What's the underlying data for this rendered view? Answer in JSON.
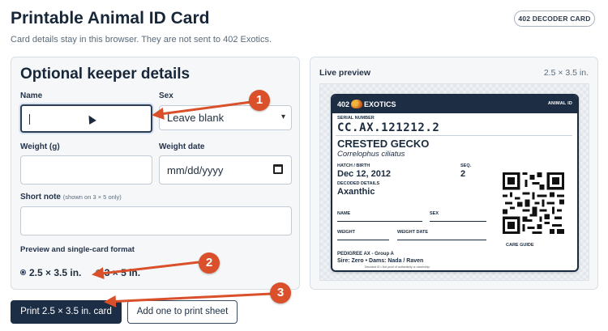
{
  "header": {
    "title": "Printable Animal ID Card",
    "subtitle": "Card details stay in this browser. They are not sent to 402 Exotics.",
    "decoder_button": "402 DECODER CARD"
  },
  "form": {
    "title": "Optional keeper details",
    "name_label": "Name",
    "name_value": "",
    "sex_label": "Sex",
    "sex_selected": "Leave blank",
    "weight_label": "Weight (g)",
    "weight_value": "",
    "weight_date_label": "Weight date",
    "weight_date_value": "mm/dd/yyyy",
    "note_label": "Short note",
    "note_hint": "(shown on 3 × 5 only)",
    "note_value": "",
    "format_label": "Preview and single-card format",
    "format_options": [
      "2.5 × 3.5 in.",
      "3 × 5 in."
    ],
    "format_selected": "2.5 × 3.5 in."
  },
  "actions": {
    "print_label": "Print 2.5 × 3.5 in. card",
    "add_label": "Add one to print sheet"
  },
  "preview": {
    "title": "Live preview",
    "size": "2.5 × 3.5 in.",
    "card": {
      "brand": "402",
      "brand_suffix": "EXOTICS",
      "animal_id_label": "ANIMAL ID",
      "serial_label": "SERIAL NUMBER",
      "serial": "CC.AX.121212.2",
      "species": "CRESTED GECKO",
      "scientific": "Correlophus ciliatus",
      "hatch_label": "HATCH / BIRTH",
      "hatch": "Dec 12, 2012",
      "seq_label": "SEQ.",
      "seq": "2",
      "decoded_label": "DECODED DETAILS",
      "decoded": "Axanthic",
      "name_field": "NAME",
      "sex_field": "SEX",
      "weight_field": "WEIGHT",
      "weight_date_field": "WEIGHT DATE",
      "care_guide": "CARE GUIDE",
      "pedigree": "PEDIGREE AX - Group A",
      "parents": "Sire: Zero • Dams: Nada / Raven",
      "disclaimer": "Decoded ID • Not proof of authenticity or ownership."
    }
  },
  "annotations": [
    "1",
    "2",
    "3"
  ],
  "colors": {
    "accent": "#d9502a",
    "navy": "#1b2e46"
  }
}
